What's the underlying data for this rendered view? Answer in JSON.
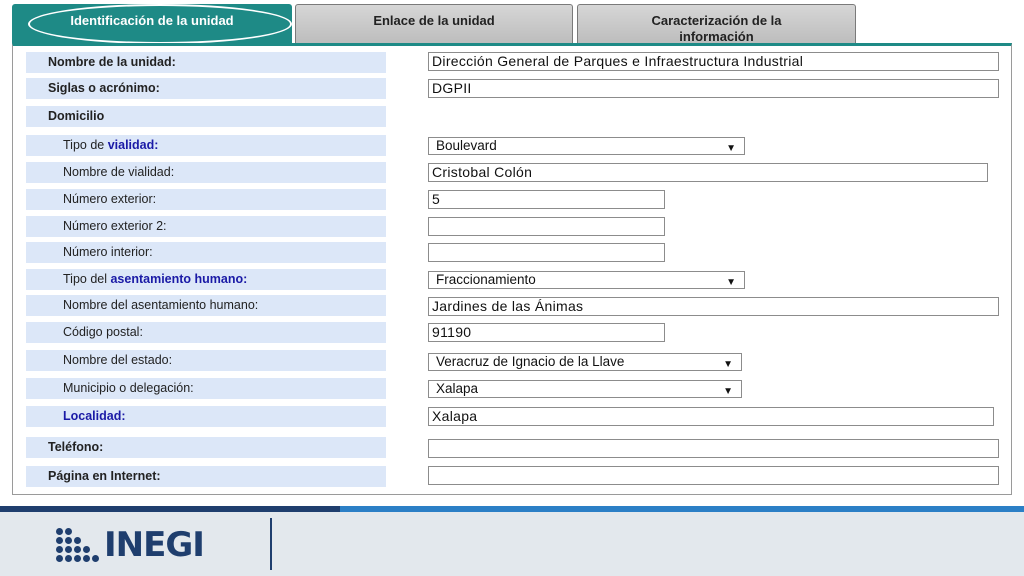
{
  "tabs": [
    {
      "label": "Identificación de la unidad",
      "active": true
    },
    {
      "label_line1": "Enlace de la unidad"
    },
    {
      "label_line1": "Caracterización de la",
      "label_line2": "información"
    }
  ],
  "fields": {
    "nombre_unidad": {
      "label": "Nombre de la unidad:",
      "value": "Dirección General de Parques e Infraestructura Industrial"
    },
    "siglas": {
      "label": "Siglas o acrónimo:",
      "value": "DGPII"
    },
    "domicilio": {
      "label": "Domicilio"
    },
    "tipo_vialidad": {
      "label_prefix": "Tipo de ",
      "label_link": "vialidad:",
      "value": "Boulevard"
    },
    "nombre_vialidad": {
      "label": "Nombre de vialidad:",
      "value": "Cristobal Colón"
    },
    "numero_exterior": {
      "label": "Número exterior:",
      "value": "5"
    },
    "numero_exterior2": {
      "label": "Número exterior 2:",
      "value": ""
    },
    "numero_interior": {
      "label": "Número interior:",
      "value": ""
    },
    "tipo_asentamiento": {
      "label_prefix": "Tipo del ",
      "label_link": "asentamiento humano:",
      "value": "Fraccionamiento"
    },
    "nombre_asentamiento": {
      "label": "Nombre del asentamiento humano:",
      "value": "Jardines de las Ánimas"
    },
    "codigo_postal": {
      "label": "Código postal:",
      "value": "91190"
    },
    "nombre_estado": {
      "label": "Nombre del estado:",
      "value": "Veracruz de Ignacio de la Llave"
    },
    "municipio": {
      "label": "Municipio o delegación:",
      "value": "Xalapa"
    },
    "localidad": {
      "label": "Localidad:",
      "value": "Xalapa"
    },
    "telefono": {
      "label": "Teléfono:",
      "value": ""
    },
    "pagina": {
      "label": "Página en Internet:",
      "value": ""
    }
  },
  "footer": {
    "logo_text": "INEGI"
  },
  "colors": {
    "tab_active": "#1e8a86",
    "label_bg": "#dce7f8",
    "link": "#1a1aa6",
    "brand": "#1f3e6e",
    "accent": "#2b7fc6"
  }
}
